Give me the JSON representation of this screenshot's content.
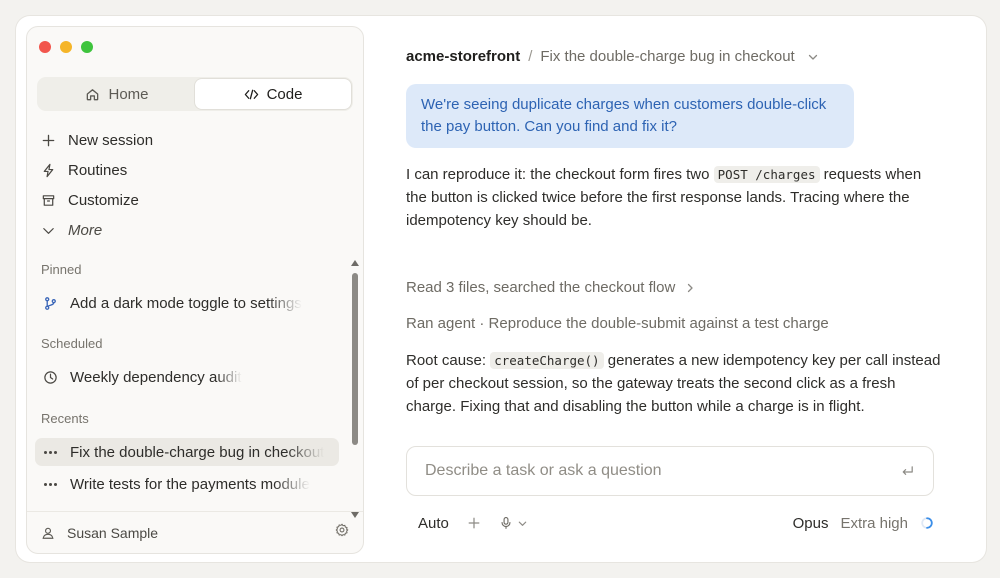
{
  "sidebar": {
    "tabs": [
      {
        "label": "Home",
        "icon": "home-icon"
      },
      {
        "label": "Code",
        "icon": "code-icon"
      }
    ],
    "menu": [
      {
        "label": "New session",
        "icon": "plus-icon"
      },
      {
        "label": "Routines",
        "icon": "bolt-icon"
      },
      {
        "label": "Customize",
        "icon": "archive-icon"
      },
      {
        "label": "More",
        "icon": "chevron-down-icon"
      }
    ],
    "pinned_label": "Pinned",
    "pinned": [
      {
        "label": "Add a dark mode toggle to settings",
        "icon": "branch-icon"
      }
    ],
    "scheduled_label": "Scheduled",
    "scheduled": [
      {
        "label": "Weekly dependency audit",
        "icon": "clock-icon"
      }
    ],
    "recents_label": "Recents",
    "recents": [
      {
        "label": "Fix the double-charge bug in checkout"
      },
      {
        "label": "Write tests for the payments module"
      }
    ],
    "user_name": "Susan Sample"
  },
  "main": {
    "repo": "acme-storefront",
    "separator": "/",
    "task_title": "Fix the double-charge bug in checkout",
    "user_message": "We're seeing duplicate charges when customers double-click the pay button. Can you find and fix it?",
    "reply1": {
      "before": "I can reproduce it: the checkout form fires two",
      "code": "POST /charges",
      "after": "requests when the button is clicked twice before the first response lands. Tracing where the idempotency key should be."
    },
    "activity1": "Read 3 files, searched the checkout flow",
    "activity2": "Ran agent · Reproduce the double-submit against a test charge",
    "reply2": {
      "before": "Root cause:",
      "code": "createCharge()",
      "after": "generates a new idempotency key per call instead of per checkout session, so the gateway treats the second click as a fresh charge. Fixing that and disabling the button while a charge is in flight."
    },
    "composer_placeholder": "Describe a task or ask a question",
    "toolbar": {
      "mode": "Auto",
      "model": "Opus",
      "effort": "Extra high"
    }
  },
  "colors": {
    "accent_blue": "#2d63b3",
    "bubble_bg": "#dde9f9",
    "spinner": "#3b8ee8"
  }
}
